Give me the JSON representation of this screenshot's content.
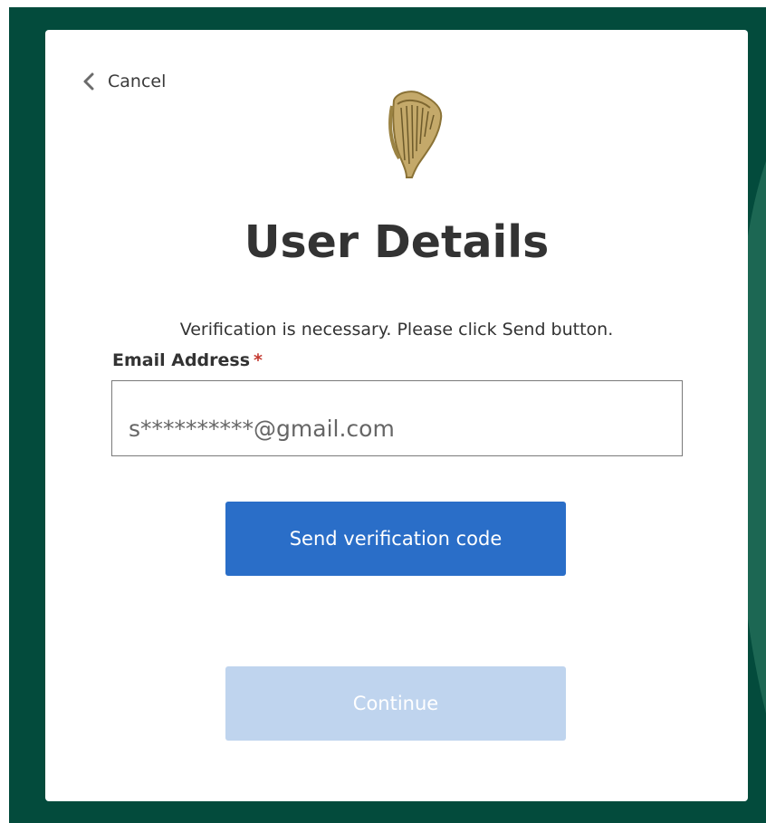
{
  "colors": {
    "background": "#034b3c",
    "primary_button": "#2a6ec8",
    "disabled_button": "#bfd4ee",
    "required_mark": "#c43a31",
    "logo_gold": "#b79a55"
  },
  "nav": {
    "cancel_label": "Cancel",
    "cancel_icon": "chevron-left-icon"
  },
  "logo": {
    "icon": "harp-icon"
  },
  "page": {
    "title": "User Details",
    "intro": "Verification is necessary. Please click Send button."
  },
  "form": {
    "email_label": "Email Address",
    "required_mark": "*",
    "email_value": "s**********@gmail.com"
  },
  "actions": {
    "send_label": "Send verification code",
    "continue_label": "Continue",
    "continue_disabled": true
  }
}
